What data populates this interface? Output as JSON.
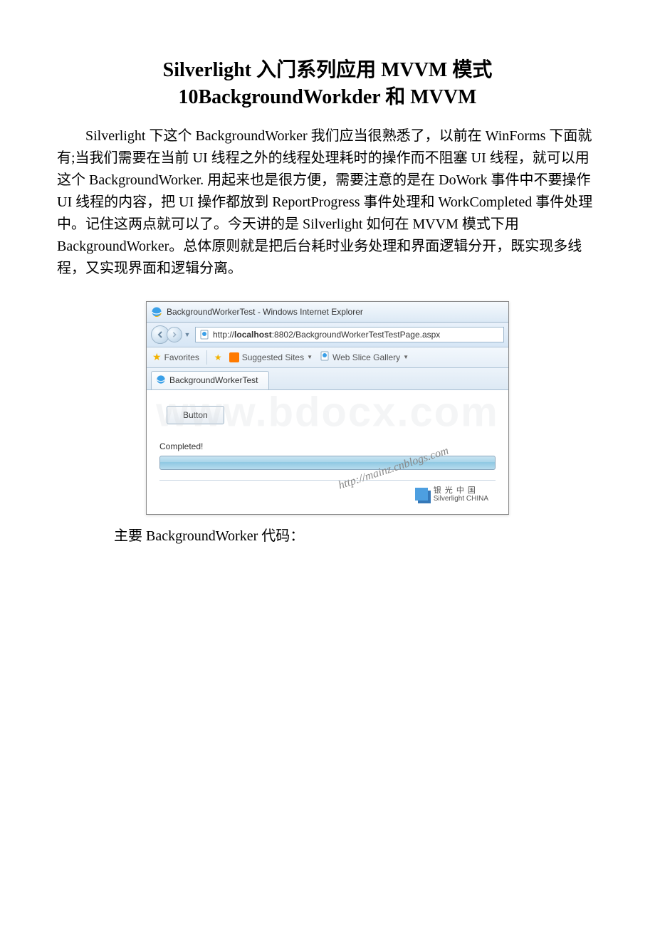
{
  "title_line1": "Silverlight 入门系列应用 MVVM 模式",
  "title_line2": "10BackgroundWorkder 和 MVVM",
  "paragraph": "Silverlight 下这个 BackgroundWorker 我们应当很熟悉了，以前在 WinForms 下面就有;当我们需要在当前 UI 线程之外的线程处理耗时的操作而不阻塞 UI 线程，就可以用这个 BackgroundWorker. 用起来也是很方便，需要注意的是在 DoWork 事件中不要操作 UI 线程的内容，把 UI 操作都放到 ReportProgress 事件处理和 WorkCompleted 事件处理中。记住这两点就可以了。今天讲的是 Silverlight 如何在 MVVM 模式下用 BackgroundWorker。总体原则就是把后台耗时业务处理和界面逻辑分开，既实现多线程，又实现界面和逻辑分离。",
  "caption": "主要 BackgroundWorker 代码：",
  "browser": {
    "window_title": "BackgroundWorkerTest - Windows Internet Explorer",
    "url_prefix": "http://",
    "url_host": "localhost",
    "url_port_path": ":8802/BackgroundWorkerTestTestPage.aspx",
    "favorites_label": "Favorites",
    "suggested_sites": "Suggested Sites",
    "web_slice": "Web Slice Gallery",
    "tab_label": "BackgroundWorkerTest",
    "button_label": "Button",
    "status": "Completed!",
    "sl_china_line1": "银 光 中 国",
    "sl_china_line2": "Silverlight CHINA",
    "watermark_url": "http://mainz.cnblogs.com"
  },
  "big_watermark": "www.bdocx.com"
}
